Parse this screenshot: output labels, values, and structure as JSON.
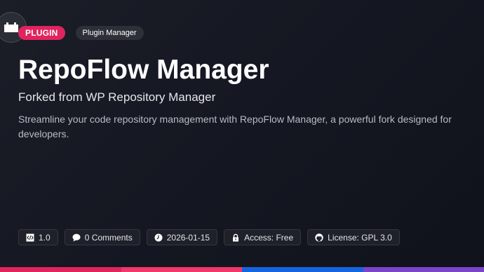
{
  "header": {
    "type_badge": "PLUGIN",
    "category_badge": "Plugin Manager",
    "plugin_icon": "plugin-icon"
  },
  "main": {
    "title": "RepoFlow Manager",
    "subtitle": "Forked from WP Repository Manager",
    "description": "Streamline your code repository management with RepoFlow Manager, a powerful fork designed for developers."
  },
  "meta": {
    "version": "1.0",
    "comments": "0 Comments",
    "date": "2026-01-15",
    "access": "Access: Free",
    "license": "License: GPL 3.0"
  },
  "icons": {
    "version": "code-file-icon",
    "comments": "speech-bubble-icon",
    "date": "clock-icon",
    "access": "lock-icon",
    "license": "github-icon"
  },
  "colors": {
    "accent": "#e0245e",
    "bar": [
      "#e0245e",
      "#f0386b",
      "#1565e0",
      "#7a45c8"
    ]
  }
}
